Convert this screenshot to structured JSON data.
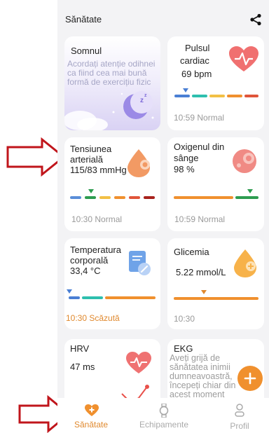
{
  "header": {
    "title": "Sănătate"
  },
  "cards": {
    "sleep": {
      "title": "Somnul",
      "desc": "Acordați atenție odihnei ca fiind cea mai bună formă de exercițiu fizic"
    },
    "pulse": {
      "title_line1": "Pulsul",
      "title_line2": "cardiac",
      "value": "69 bpm",
      "footer": "10:59 Normal"
    },
    "bp": {
      "title_line1": "Tensiunea",
      "title_line2": "arterială",
      "value": "115/83 mmHg",
      "footer": "10:30 Normal"
    },
    "oxygen": {
      "title_line1": "Oxigenul din",
      "title_line2": "sânge",
      "value": "98 %",
      "footer": "10:59 Normal"
    },
    "temp": {
      "title_line1": "Temperatura",
      "title_line2": "corporală",
      "value": "33,4 °C",
      "footer": "10:30 Scăzută"
    },
    "glucose": {
      "title": "Glicemia",
      "value": "5.22 mmol/L",
      "footer": "10:30"
    },
    "hrv": {
      "title": "HRV",
      "value": "47 ms"
    },
    "ekg": {
      "title": "EKG",
      "desc": "Aveți grijă de sănătatea inimii dumneavoastră, începeți chiar din acest moment"
    }
  },
  "tabs": {
    "health": "Sănătate",
    "devices": "Echipamente",
    "profile": "Profil"
  },
  "colors": {
    "accent": "#f0902e",
    "annotation_arrow": "#c0151b"
  }
}
